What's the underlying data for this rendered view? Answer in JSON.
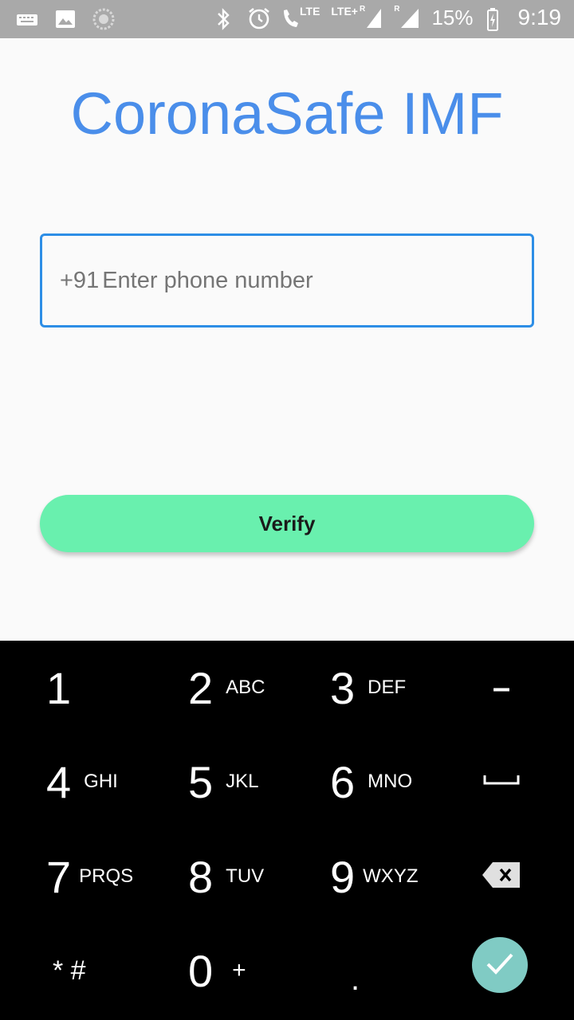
{
  "status_bar": {
    "icons_left": [
      "keyboard-icon",
      "image-icon",
      "circle-icon"
    ],
    "icons_right": [
      "bluetooth-icon",
      "alarm-icon",
      "volte-call-icon",
      "lte-signal-icon",
      "signal-r-icon"
    ],
    "lte_label": "LTE",
    "lte_plus_label": "LTE+",
    "roaming_label": "R",
    "battery": "15%",
    "time": "9:19"
  },
  "app": {
    "title": "CoronaSafe IMF",
    "phone_prefix": "+91",
    "phone_placeholder": "Enter phone number",
    "verify_label": "Verify",
    "accent_color": "#4a8eea",
    "button_color": "#69f0ae"
  },
  "keyboard": {
    "keys": [
      {
        "digit": "1",
        "letters": ""
      },
      {
        "digit": "2",
        "letters": "ABC"
      },
      {
        "digit": "3",
        "letters": "DEF"
      },
      {
        "digit": "4",
        "letters": "GHI"
      },
      {
        "digit": "5",
        "letters": "JKL"
      },
      {
        "digit": "6",
        "letters": "MNO"
      },
      {
        "digit": "7",
        "letters": "PRQS"
      },
      {
        "digit": "8",
        "letters": "TUV"
      },
      {
        "digit": "9",
        "letters": "WXYZ"
      },
      {
        "digit": "0",
        "letters": "+"
      }
    ],
    "star_hash": "* #",
    "dash": "–",
    "dot": ".",
    "done_color": "#80cbc4"
  }
}
